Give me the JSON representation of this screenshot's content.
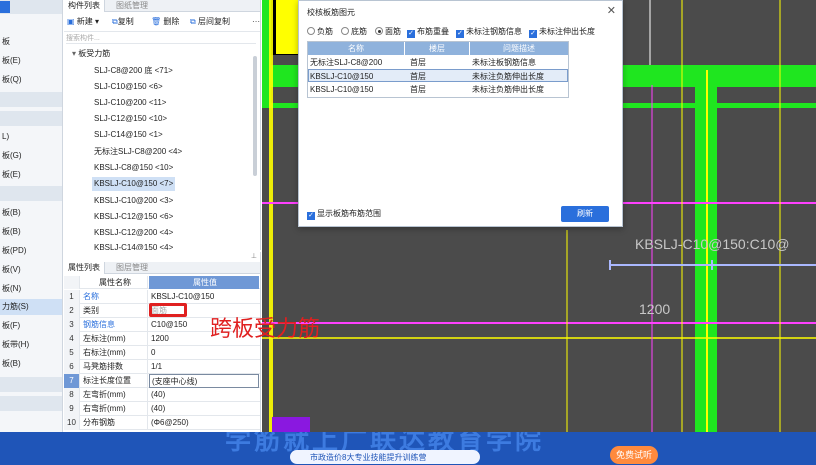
{
  "nav": {
    "items": [
      "板",
      "板(E)",
      "板(Q)",
      "L)",
      "板(G)",
      "板(E)",
      "板(B)",
      "板(B)",
      "板(PD)",
      "板(V)",
      "板(N)",
      "力筋(S)",
      "板(F)",
      "板带(H)",
      "板(B)"
    ],
    "selected_index": 11
  },
  "comp_panel": {
    "tabs": [
      "构件列表",
      "图纸管理"
    ],
    "toolbar": [
      "新建",
      "复制",
      "删除",
      "层间复制"
    ],
    "search_placeholder": "搜索构件...",
    "group_label": "板受力筋",
    "items": [
      "SLJ-C8@200 底 <71>",
      "SLJ-C10@150 <6>",
      "SLJ-C10@200 <11>",
      "SLJ-C12@150 <10>",
      "SLJ-C14@150 <1>",
      "无标注SLJ-C8@200 <4>",
      "KBSLJ-C8@150 <10>",
      "KBSLJ-C10@150 <7>",
      "KBSLJ-C10@200 <3>",
      "KBSLJ-C12@150 <6>",
      "KBSLJ-C12@200 <4>",
      "KBSLJ-C14@150 <4>"
    ],
    "selected_index": 7
  },
  "prop_panel": {
    "tabs": [
      "属性列表",
      "图层管理"
    ],
    "headers": [
      "属性名称",
      "属性值"
    ],
    "rows": [
      {
        "num": "1",
        "name": "名称",
        "value": "KBSLJ-C10@150"
      },
      {
        "num": "2",
        "name": "类别",
        "value": "面筋"
      },
      {
        "num": "3",
        "name": "钢筋信息",
        "value": "C10@150"
      },
      {
        "num": "4",
        "name": "左标注(mm)",
        "value": "1200"
      },
      {
        "num": "5",
        "name": "右标注(mm)",
        "value": "0"
      },
      {
        "num": "6",
        "name": "马凳筋排数",
        "value": "1/1"
      },
      {
        "num": "7",
        "name": "标注长度位置",
        "value": "(支座中心线)"
      },
      {
        "num": "8",
        "name": "左弯折(mm)",
        "value": "(40)"
      },
      {
        "num": "9",
        "name": "右弯折(mm)",
        "value": "(40)"
      },
      {
        "num": "10",
        "name": "分布钢筋",
        "value": "(Φ6@250)"
      }
    ],
    "annotation": "跨板受力筋"
  },
  "dialog": {
    "title": "校核板筋图元",
    "close": "✕",
    "radios": [
      "负筋",
      "底筋",
      "面筋"
    ],
    "radio_selected": 2,
    "checks": [
      "布筋重叠",
      "未标注钢筋信息",
      "未标注伸出长度"
    ],
    "columns": [
      "名称",
      "楼层",
      "问题描述"
    ],
    "rows": [
      [
        "无标注SLJ-C8@200",
        "首层",
        "未标注板钢筋信息"
      ],
      [
        "KBSLJ-C10@150",
        "首层",
        "未标注负筋伸出长度"
      ],
      [
        "KBSLJ-C10@150",
        "首层",
        "未标注负筋伸出长度"
      ]
    ],
    "selected_row": 1,
    "show_range_label": "显示板筋布筋范围",
    "refresh_label": "刷新"
  },
  "canvas": {
    "label_rebar": "KBSLJ-C10@150:C10@",
    "label_dim": "1200"
  },
  "banner": {
    "line1": "学筋就上广联达教育学院",
    "line2": "市政造价8大专业技能提升训练营",
    "cta": "免费试听"
  },
  "colors": {
    "accent": "#2a6fdc",
    "annotation_red": "#e02020",
    "green_beam": "#1fe61f",
    "banner_bg": "#1f55b8"
  }
}
